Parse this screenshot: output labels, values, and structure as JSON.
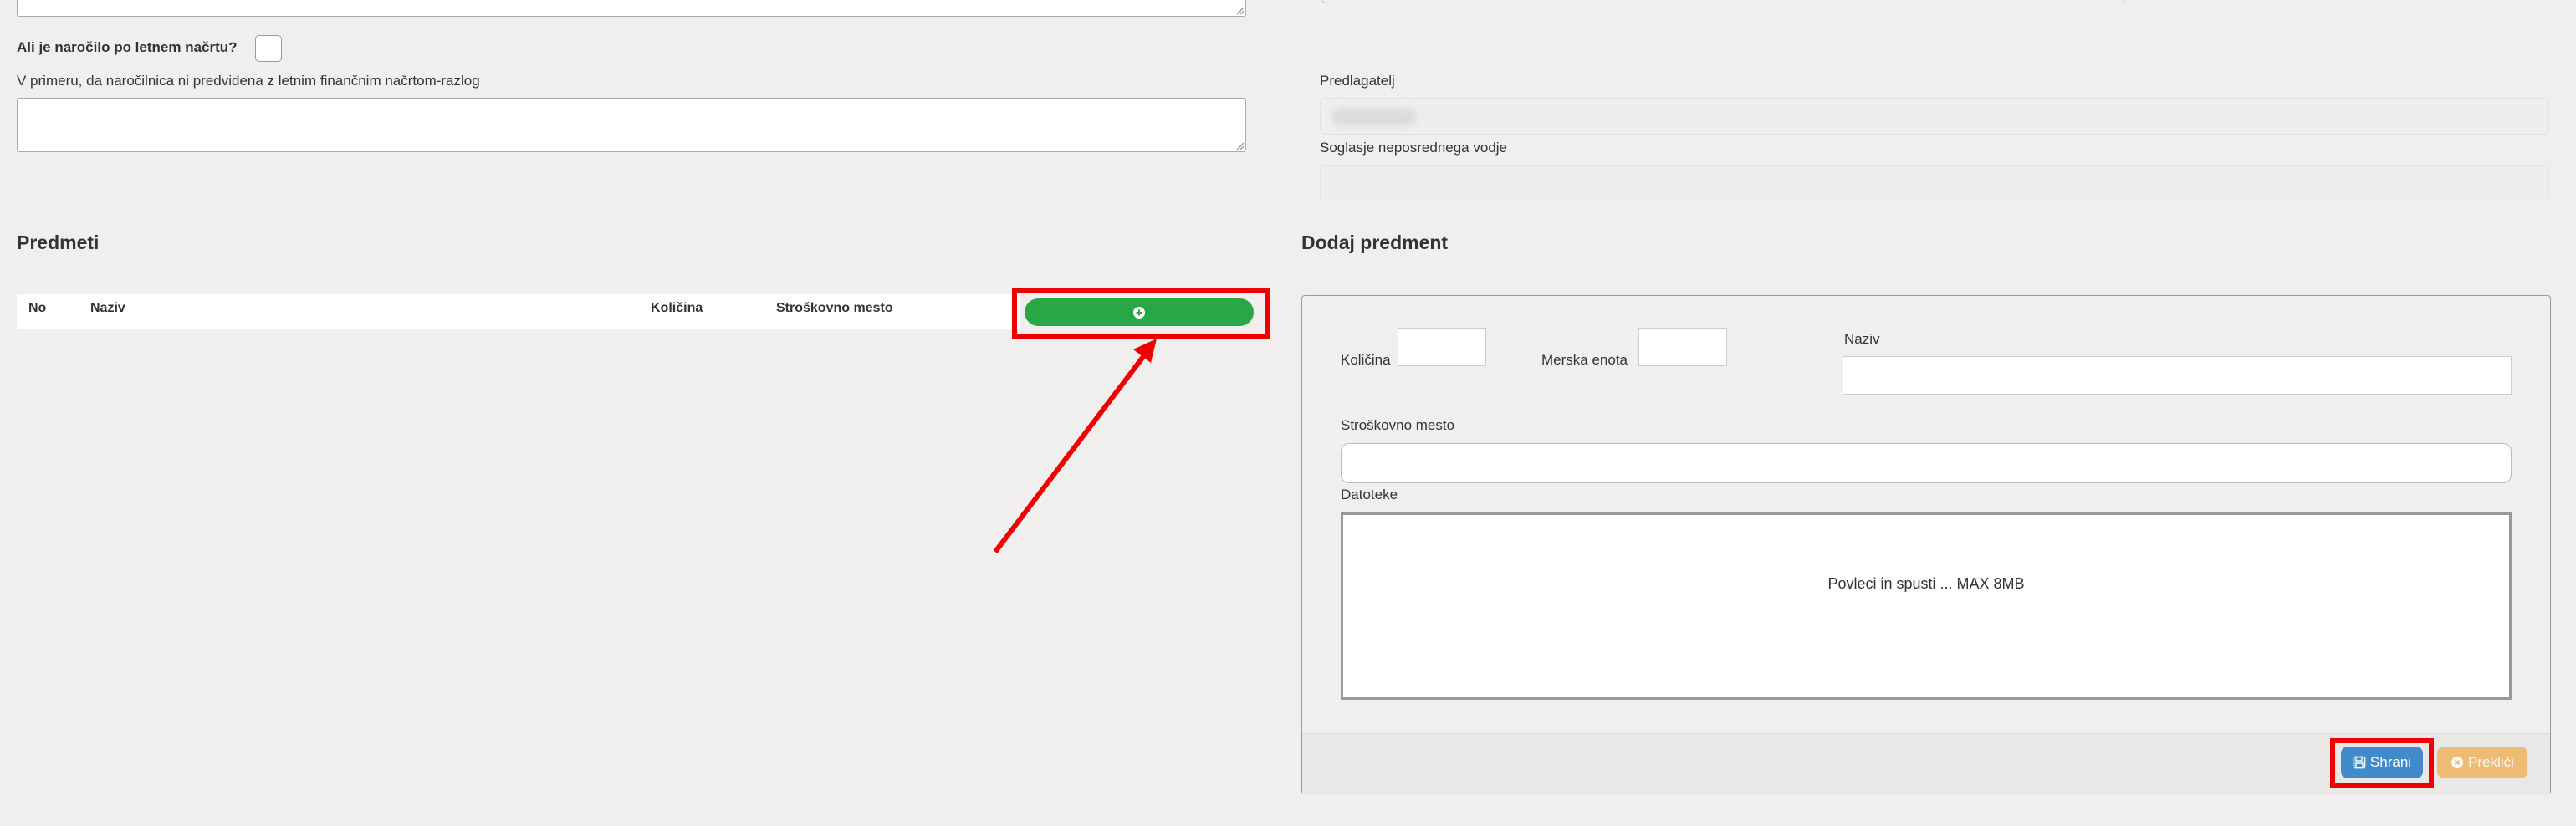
{
  "form": {
    "annual_plan_question": "Ali je naročilo po letnem načrtu?",
    "reason_label": "V primeru, da naročilnica ni predvidena z letnim finančnim načrtom-razlog",
    "proposer_label": "Predlagatelj",
    "approval_label": "Soglasje neposrednega vodje"
  },
  "items": {
    "title": "Predmeti",
    "columns": [
      "No",
      "Naziv",
      "Količina",
      "Stroškovno mesto"
    ],
    "add_icon": "plus-circle-icon"
  },
  "add_item": {
    "title": "Dodaj predment",
    "quantity_label": "Količina",
    "unit_label": "Merska enota",
    "name_label": "Naziv",
    "cost_center_label": "Stroškovno mesto",
    "files_label": "Datoteke",
    "dropzone_text": "Povleci in spusti ... MAX 8MB",
    "save_label": "Shrani",
    "save_icon": "floppy-disk-icon",
    "cancel_label": "Prekliči",
    "cancel_icon": "times-circle-icon"
  },
  "colors": {
    "add_button": "#28a745",
    "save_button": "#428bca",
    "cancel_button": "#f0ad4e",
    "highlight": "#ee0000"
  }
}
